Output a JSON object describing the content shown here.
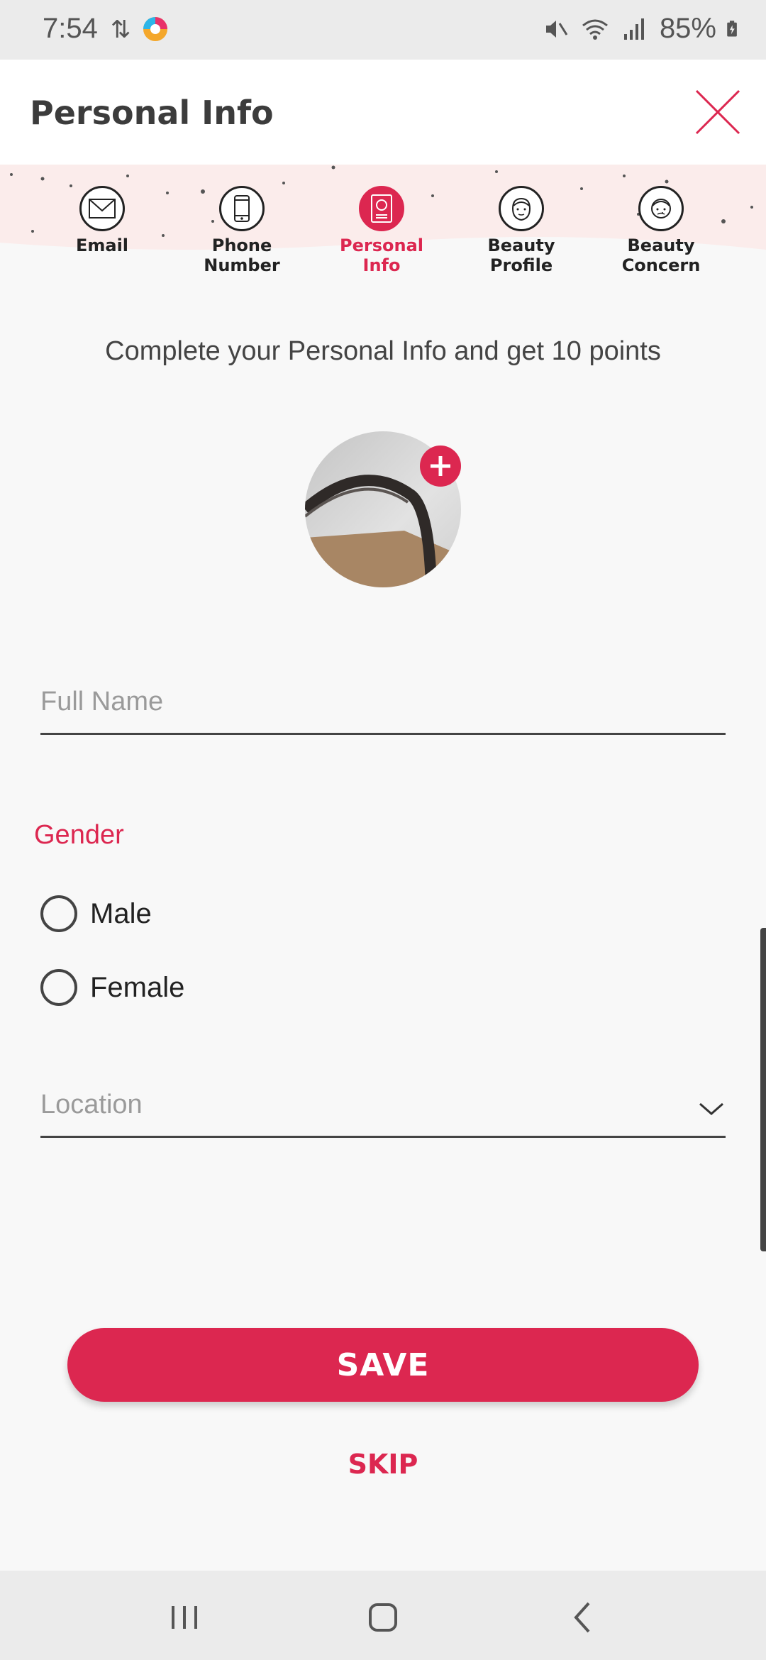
{
  "status_bar": {
    "time": "7:54",
    "battery": "85%"
  },
  "header": {
    "title": "Personal Info"
  },
  "steps": [
    {
      "label": "Email",
      "icon": "envelope-icon",
      "active": false
    },
    {
      "label": "Phone\nNumber",
      "icon": "phone-icon",
      "active": false
    },
    {
      "label": "Personal\nInfo",
      "icon": "id-card-icon",
      "active": true
    },
    {
      "label": "Beauty\nProfile",
      "icon": "face-icon",
      "active": false
    },
    {
      "label": "Beauty\nConcern",
      "icon": "face-concern-icon",
      "active": false
    }
  ],
  "intro_text": "Complete your Personal Info and get 10 points",
  "form": {
    "full_name_placeholder": "Full Name",
    "gender_label": "Gender",
    "male_label": "Male",
    "female_label": "Female",
    "location_placeholder": "Location"
  },
  "actions": {
    "save_label": "SAVE",
    "skip_label": "SKIP"
  },
  "colors": {
    "accent": "#dc2750",
    "stepper_band": "#fbeceb"
  }
}
